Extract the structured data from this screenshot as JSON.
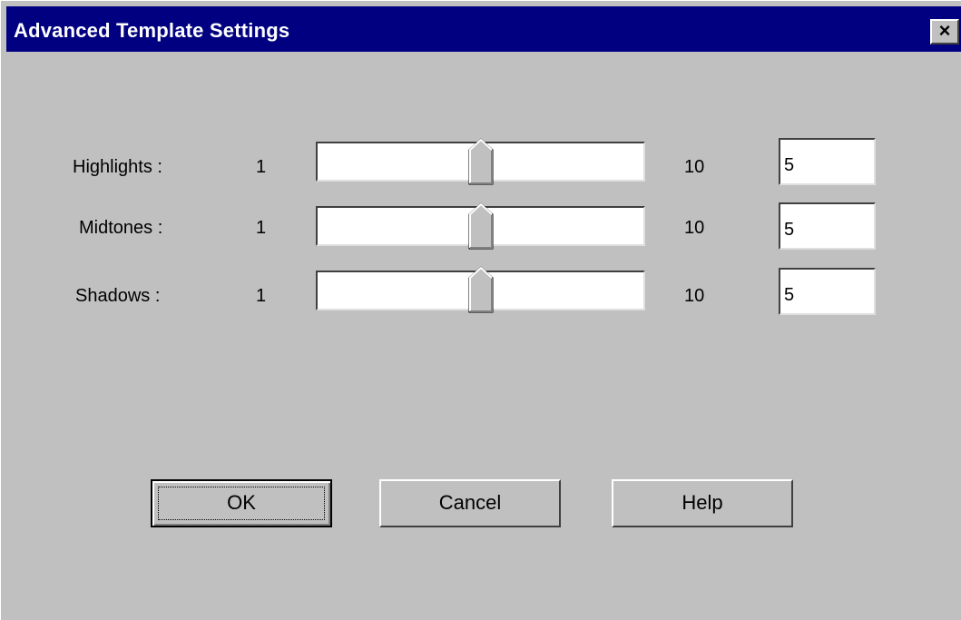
{
  "window": {
    "title": "Advanced Template Settings",
    "close_label": "×"
  },
  "sliders": [
    {
      "label": "Highlights :",
      "min_label": "1",
      "max_label": "10",
      "value": "5",
      "position": 0.5
    },
    {
      "label": "Midtones :",
      "min_label": "1",
      "max_label": "10",
      "value": "5",
      "position": 0.5
    },
    {
      "label": "Shadows :",
      "min_label": "1",
      "max_label": "10",
      "value": "5",
      "position": 0.5
    }
  ],
  "buttons": {
    "ok": "OK",
    "cancel": "Cancel",
    "help": "Help"
  },
  "colors": {
    "titlebar": "#000080",
    "face": "#c0c0c0"
  }
}
